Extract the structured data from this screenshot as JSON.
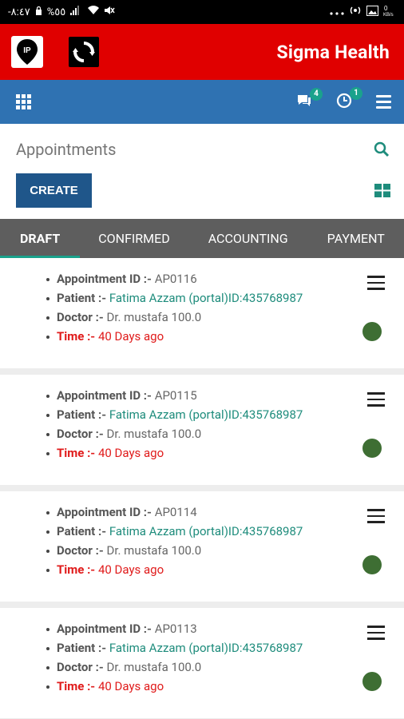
{
  "status_bar": {
    "left_text": "-٨:٤٧",
    "battery_percent": "%٥٥"
  },
  "app_bar": {
    "brand": "Sigma Health",
    "logo_text": "IP"
  },
  "nav_bar": {
    "messages_count": "4",
    "activity_count": "1"
  },
  "control": {
    "title": "Appointments",
    "create_label": "CREATE"
  },
  "tabs": [
    {
      "label": "DRAFT",
      "active": true
    },
    {
      "label": "CONFIRMED",
      "active": false
    },
    {
      "label": "ACCOUNTING",
      "active": false
    },
    {
      "label": "PAYMENT",
      "active": false
    }
  ],
  "labels": {
    "appointment_id": "Appointment ID :-",
    "patient": "Patient :-",
    "doctor": "Doctor :-",
    "time": "Time :-"
  },
  "appointments": [
    {
      "id": "AP0116",
      "patient": "Fatima Azzam (portal)ID:435768987",
      "doctor": "Dr. mustafa 100.0",
      "time": "40 Days ago",
      "status_color": "#3e6e33"
    },
    {
      "id": "AP0115",
      "patient": "Fatima Azzam (portal)ID:435768987",
      "doctor": "Dr. mustafa 100.0",
      "time": "40 Days ago",
      "status_color": "#3e6e33"
    },
    {
      "id": "AP0114",
      "patient": "Fatima Azzam (portal)ID:435768987",
      "doctor": "Dr. mustafa 100.0",
      "time": "40 Days ago",
      "status_color": "#3e6e33"
    },
    {
      "id": "AP0113",
      "patient": "Fatima Azzam (portal)ID:435768987",
      "doctor": "Dr. mustafa 100.0",
      "time": "40 Days ago",
      "status_color": "#3e6e33"
    }
  ],
  "colors": {
    "app_bar": "#e00000",
    "nav_bar": "#2f72b2",
    "accent": "#1aa28c",
    "tabs_bg": "#5e5e5e",
    "create_button": "#1f568a",
    "time_text": "#e01b1b"
  }
}
